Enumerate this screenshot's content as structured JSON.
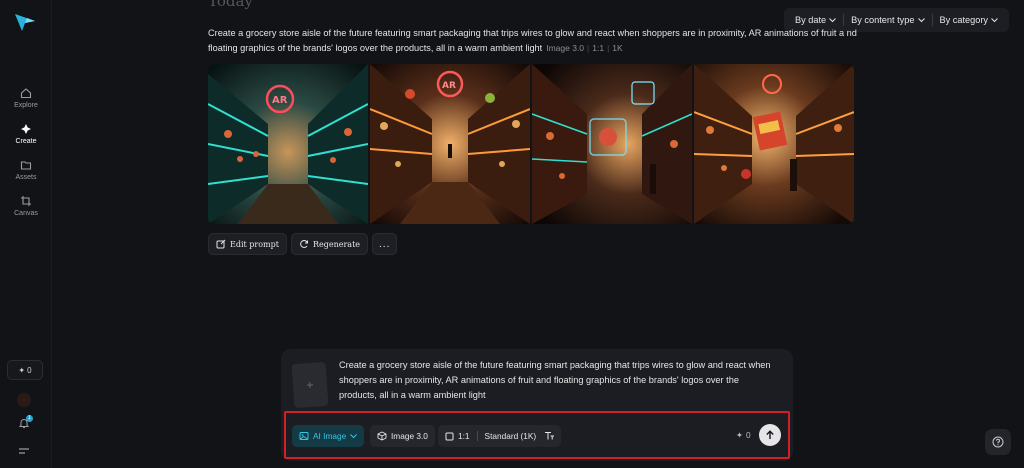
{
  "sidebar": {
    "items": [
      {
        "label": "Explore",
        "icon": "home-icon"
      },
      {
        "label": "Create",
        "icon": "sparkle-icon",
        "active": true
      },
      {
        "label": "Assets",
        "icon": "folder-icon"
      },
      {
        "label": "Canvas",
        "icon": "crop-icon"
      }
    ],
    "credits": "0",
    "notification_count": "1"
  },
  "main": {
    "section_title": "Today",
    "prompt": "Create a grocery store aisle of the future featuring smart packaging that trips wires to glow and react when shoppers are in proximity, AR animations of fruit a nd floating graphics of the brands' logos over the products, all in a warm ambient light",
    "meta": {
      "model": "Image 3.0",
      "ratio": "1:1",
      "resolution": "1K"
    },
    "images": [
      {
        "icon": "generated-image-1",
        "sign": "AR"
      },
      {
        "icon": "generated-image-2",
        "sign": "AR"
      },
      {
        "icon": "generated-image-3",
        "sign": ""
      },
      {
        "icon": "generated-image-4",
        "sign": ""
      }
    ],
    "actions": {
      "edit": "Edit prompt",
      "regenerate": "Regenerate",
      "more": "..."
    }
  },
  "filters": {
    "date": "By date",
    "content_type": "By content type",
    "category": "By category"
  },
  "composer": {
    "prompt": "Create a grocery store aisle of the future featuring smart packaging that trips wires to glow and react when shoppers are in proximity, AR animations of fruit and floating graphics of the brands' logos over the products, all in a warm ambient light",
    "add_label": "+",
    "toolbar": {
      "mode": "AI Image",
      "model": "Image 3.0",
      "ratio": "1:1",
      "quality": "Standard (1K)",
      "credits": "0"
    }
  },
  "colors": {
    "accent": "#39c5e3",
    "highlight": "#d41f26",
    "background": "#121316"
  }
}
